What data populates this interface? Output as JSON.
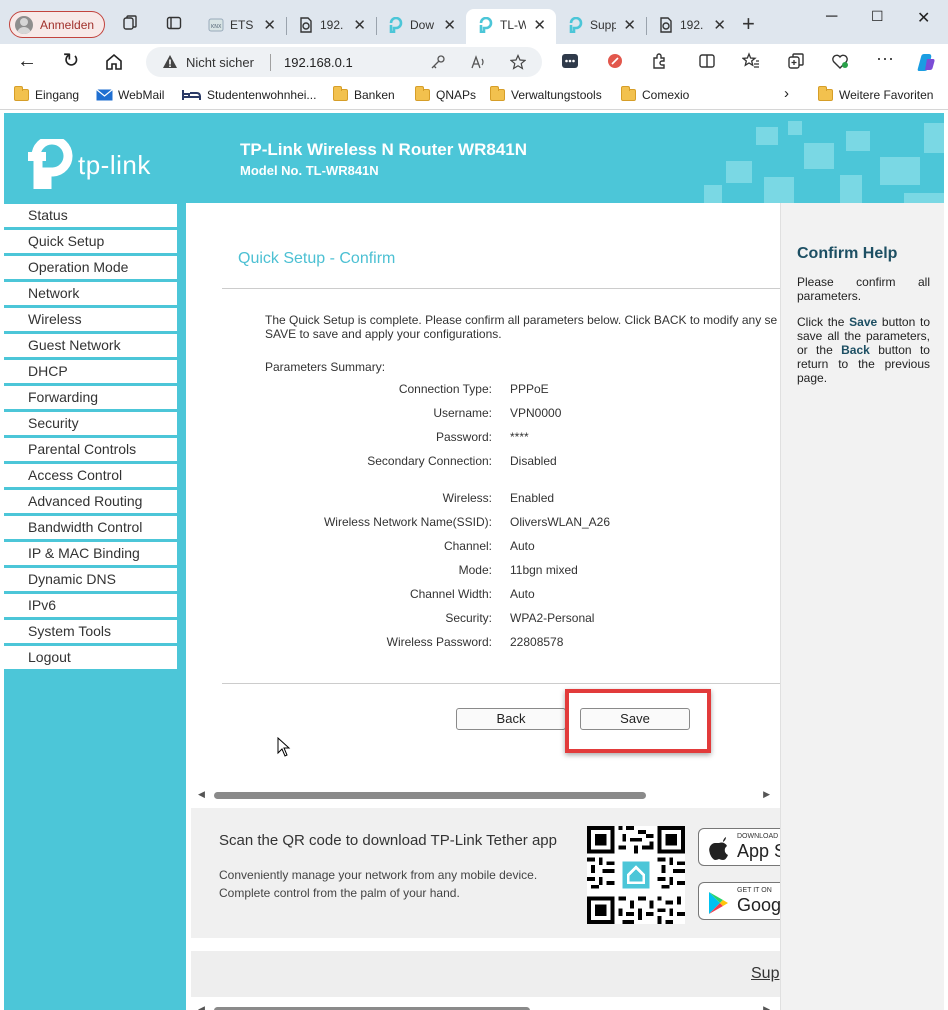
{
  "browser": {
    "profile_label": "Anmelden",
    "tabs": [
      {
        "title": "ETS",
        "active": false
      },
      {
        "title": "192.",
        "active": false
      },
      {
        "title": "Dow",
        "active": false
      },
      {
        "title": "TL-W",
        "active": true
      },
      {
        "title": "Supp",
        "active": false
      },
      {
        "title": "192.",
        "active": false
      }
    ],
    "security_label": "Nicht sicher",
    "url": "192.168.0.1",
    "bookmarks": [
      "Eingang",
      "WebMail",
      "Studentenwohnhei...",
      "Banken",
      "QNAPs",
      "Verwaltungstools",
      "Comexio"
    ],
    "more_favorites": "Weitere Favoriten"
  },
  "router": {
    "logo_text": "tp-link",
    "title": "TP-Link Wireless N Router WR841N",
    "model": "Model No. TL-WR841N",
    "menu": [
      "Status",
      "Quick Setup",
      "Operation Mode",
      "Network",
      "Wireless",
      "Guest Network",
      "DHCP",
      "Forwarding",
      "Security",
      "Parental Controls",
      "Access Control",
      "Advanced Routing",
      "Bandwidth Control",
      "IP & MAC Binding",
      "Dynamic DNS",
      "IPv6",
      "System Tools",
      "Logout"
    ],
    "page_title": "Quick Setup - Confirm",
    "intro_line1": "The Quick Setup is complete. Please confirm all parameters below. Click BACK to modify any se",
    "intro_line2": "SAVE to save and apply your configurations.",
    "params_summary": "Parameters Summary:",
    "params": [
      {
        "label": "Connection Type:",
        "value": "PPPoE"
      },
      {
        "label": "Username:",
        "value": "VPN0000"
      },
      {
        "label": "Password:",
        "value": "****"
      },
      {
        "label": "Secondary Connection:",
        "value": "Disabled"
      },
      {
        "label": "Wireless:",
        "value": "Enabled"
      },
      {
        "label": "Wireless Network Name(SSID):",
        "value": "OliversWLAN_A26"
      },
      {
        "label": "Channel:",
        "value": "Auto"
      },
      {
        "label": "Mode:",
        "value": "11bgn mixed"
      },
      {
        "label": "Channel Width:",
        "value": "Auto"
      },
      {
        "label": "Security:",
        "value": "WPA2-Personal"
      },
      {
        "label": "Wireless Password:",
        "value": "22808578"
      }
    ],
    "back_label": "Back",
    "save_label": "Save",
    "app_title": "Scan the QR code to download TP-Link Tether app",
    "app_sub1": "Conveniently manage your network from any mobile device.",
    "app_sub2": "Complete control from the palm of your hand.",
    "appstore_small": "DOWNLOAD",
    "appstore_big": "App S",
    "googleplay_small": "GET IT ON",
    "googleplay_big": "Googl",
    "footer_link": "Sup",
    "help_title": "Confirm Help",
    "help_p1": "Please confirm all parameters.",
    "help_p2_a": "Click the",
    "help_p2_save": "Save",
    "help_p2_b": "button to save all the parameters, or the",
    "help_p2_back": "Back",
    "help_p2_c": "button to return to the previous page."
  },
  "colors": {
    "brand": "#4cc6d8",
    "title": "#4cc0d3",
    "highlight": "#e23b3b"
  }
}
